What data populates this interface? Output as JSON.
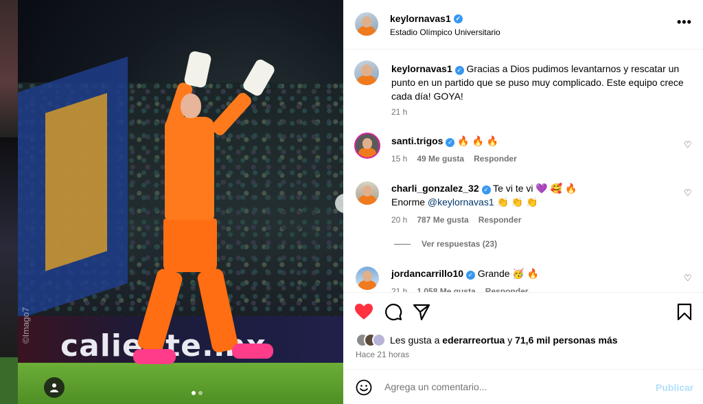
{
  "post": {
    "username": "keylornavas1",
    "location": "Estadio Olímpico Universitario",
    "more_label": "•••",
    "photo_watermark": "©Imago7",
    "banner_text": "caliente.mx",
    "caption": "Gracias a Dios pudimos levantarnos y rescatar un punto en un partido que se puso muy complicado. Este equipo crece cada día! GOYA!",
    "caption_time": "21 h",
    "carousel_total": 2,
    "carousel_active": 1
  },
  "comments": [
    {
      "username": "santi.trigos",
      "text": "🔥 🔥 🔥",
      "time": "15 h",
      "likes": "49 Me gusta",
      "reply_label": "Responder"
    },
    {
      "username": "charli_gonzalez_32",
      "text": "Te vi te vi 💜 🥰 🔥",
      "line2_mention": "@keylornavas1",
      "line2_text": "👏 👏 👏",
      "line2_prefix": "Enorme",
      "time": "20 h",
      "likes": "787 Me gusta",
      "reply_label": "Responder",
      "view_replies": "Ver respuestas (23)"
    },
    {
      "username": "jordancarrillo10",
      "text": "Grande 🥳 🔥",
      "time": "21 h",
      "likes": "1.058 Me gusta",
      "reply_label": "Responder"
    }
  ],
  "actions": {
    "liked": true,
    "like_color": "#ff3040",
    "likes_prefix": "Les gusta a",
    "likes_user": "ederarreortua",
    "likes_mid": "y",
    "likes_rest": "71,6 mil personas más",
    "posted_when": "Hace 21 horas"
  },
  "add_comment": {
    "placeholder": "Agrega un comentario...",
    "publish_label": "Publicar"
  },
  "colors": {
    "verified": "#3897f0",
    "publish_disabled": "#b2dffc",
    "muted": "#737373"
  }
}
